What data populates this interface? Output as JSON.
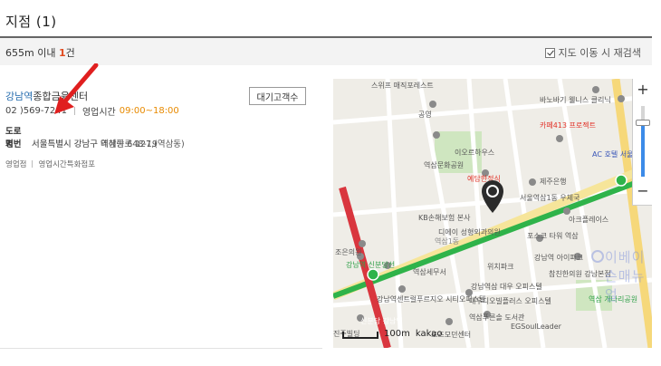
{
  "page": {
    "title": "지점 (1)"
  },
  "filter": {
    "distance": "655m 이내",
    "count": "1",
    "count_unit": "건",
    "recheck_label": "지도 이동 시 재검색",
    "recheck_checked": true
  },
  "branch": {
    "name_keyword": "강남역",
    "name_rest": "종합금융센터",
    "wait_button": "대기고객수",
    "phone": "02 )569-7241",
    "hours_label": "영업시간",
    "hours_value": "09:00~18:00",
    "road_label": "도로명",
    "road_address": "서울특별시 강남구 테헤란로 127,(역삼동)",
    "lot_label": "지번",
    "lot_address": "서울특별시 강남구 역삼동 648-19",
    "type": "영업점",
    "special_hours": "영업시간특화점포"
  },
  "map": {
    "labels": [
      "스위프 매직포레스트",
      "바노바기 웰니스 클리닉",
      "공영",
      "이오르하우스",
      "역삼문화공원",
      "카페413 프로젝트",
      "AC 호텔 서울 강남",
      "예담한정식",
      "제주은행",
      "서울역삼1동 우체국",
      "KB손해보험 본사",
      "디에이 성형외과의원",
      "아크플레이스",
      "포스코 타워 역삼",
      "역삼1동",
      "강남역 신분당선",
      "역삼세무서",
      "위치파크",
      "강남역 아이파크",
      "강남역삼 대우 오피스텔",
      "참친한의원 강남본점",
      "강남역센트럴푸르지오 시티오피스텔",
      "대우디오빌플러스 오피스텔",
      "역삼푸른솔 도서관",
      "역삼 개나리공원",
      "토즈모던센터",
      "EGSoulLeader",
      "진주빌딩",
      "조은의원",
      "신분당 강남역"
    ],
    "zoom_in": "+",
    "zoom_out": "−",
    "zoom_level": 0.75,
    "scale": "100m",
    "provider": "kakao",
    "watermark": "이베이슨매뉴얼"
  }
}
